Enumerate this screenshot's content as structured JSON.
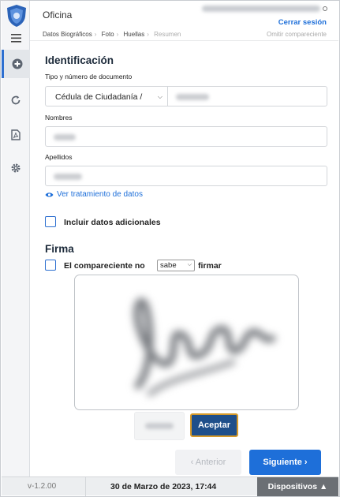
{
  "header": {
    "title": "Oficina",
    "logout_label": "Cerrar sesión"
  },
  "steps": {
    "items": [
      "Datos Biográficos",
      "Foto",
      "Huellas",
      "Resumen"
    ],
    "skip_label": "Omitir compareciente"
  },
  "identification": {
    "heading": "Identificación",
    "doc_label": "Tipo y número de documento",
    "doc_type_value": "Cédula de Ciudadanía /",
    "names_label": "Nombres",
    "surnames_label": "Apellidos",
    "privacy_link": "Ver tratamiento de datos",
    "additional_label": "Incluir datos adicionales"
  },
  "signature": {
    "heading": "Firma",
    "cannot_sign_prefix": "El compareciente no",
    "cannot_sign_option": "sabe",
    "cannot_sign_suffix": "firmar",
    "accept_label": "Aceptar"
  },
  "navigation": {
    "prev_label": "‹ Anterior",
    "next_label": "Siguiente ›"
  },
  "footer": {
    "version": "v-1.2.00",
    "date": "30 de Marzo de 2023, 17:44",
    "devices_label": "Dispositivos ▲"
  },
  "colors": {
    "accent": "#1e6fd9",
    "accept_bg": "#1f4f8a",
    "accept_border": "#d69a2a",
    "footer_devices": "#6b6f74"
  },
  "icons": [
    "shield-logo-icon",
    "hamburger-menu-icon",
    "add-circle-icon",
    "refresh-icon",
    "pdf-file-icon",
    "gear-icon",
    "eye-icon"
  ]
}
